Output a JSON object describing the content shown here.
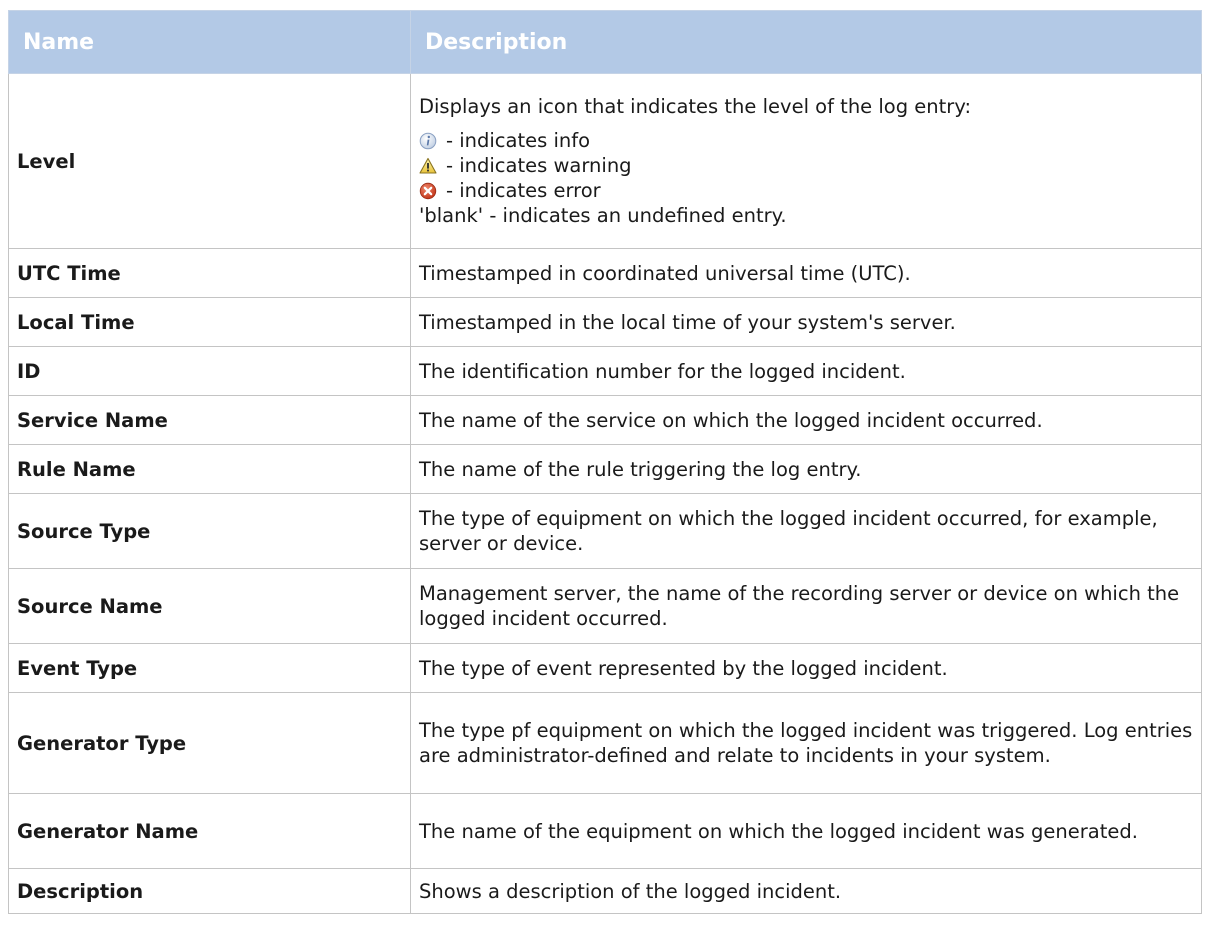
{
  "table": {
    "headers": [
      "Name",
      "Description"
    ],
    "level": {
      "name": "Level",
      "intro": "Displays an icon that indicates the level of the log entry:",
      "items": [
        {
          "icon": "info-icon",
          "text": "- indicates info"
        },
        {
          "icon": "warning-icon",
          "text": "- indicates warning"
        },
        {
          "icon": "error-icon",
          "text": "- indicates error"
        }
      ],
      "blank_text": "'blank' - indicates an undefined entry."
    },
    "rows": [
      {
        "name": "UTC Time",
        "desc": "Timestamped in coordinated universal time (UTC)."
      },
      {
        "name": "Local Time",
        "desc": "Timestamped in the local time of your system's server."
      },
      {
        "name": "ID",
        "desc": "The identification number for the logged incident."
      },
      {
        "name": "Service Name",
        "desc": "The name of the service on which the logged incident occurred."
      },
      {
        "name": "Rule Name",
        "desc": "The name of the rule triggering the log entry."
      },
      {
        "name": "Source Type",
        "desc": "The type of equipment on which the logged incident occurred, for example, server or device."
      },
      {
        "name": "Source Name",
        "desc": "Management server, the name of the recording server or device on which the logged incident occurred."
      },
      {
        "name": "Event Type",
        "desc": "The type of event represented by the logged incident."
      },
      {
        "name": "Generator Type",
        "desc": "The type pf equipment on which the logged incident was triggered. Log entries are administrator-defined and relate to incidents in your system."
      },
      {
        "name": "Generator Name",
        "desc": "The name of the equipment on which the logged incident was generated."
      },
      {
        "name": "Description",
        "desc": "Shows a description of the logged incident."
      }
    ]
  },
  "colors": {
    "header_bg": "#b3c9e6",
    "header_text": "#ffffff",
    "border": "#c4c4c4"
  }
}
